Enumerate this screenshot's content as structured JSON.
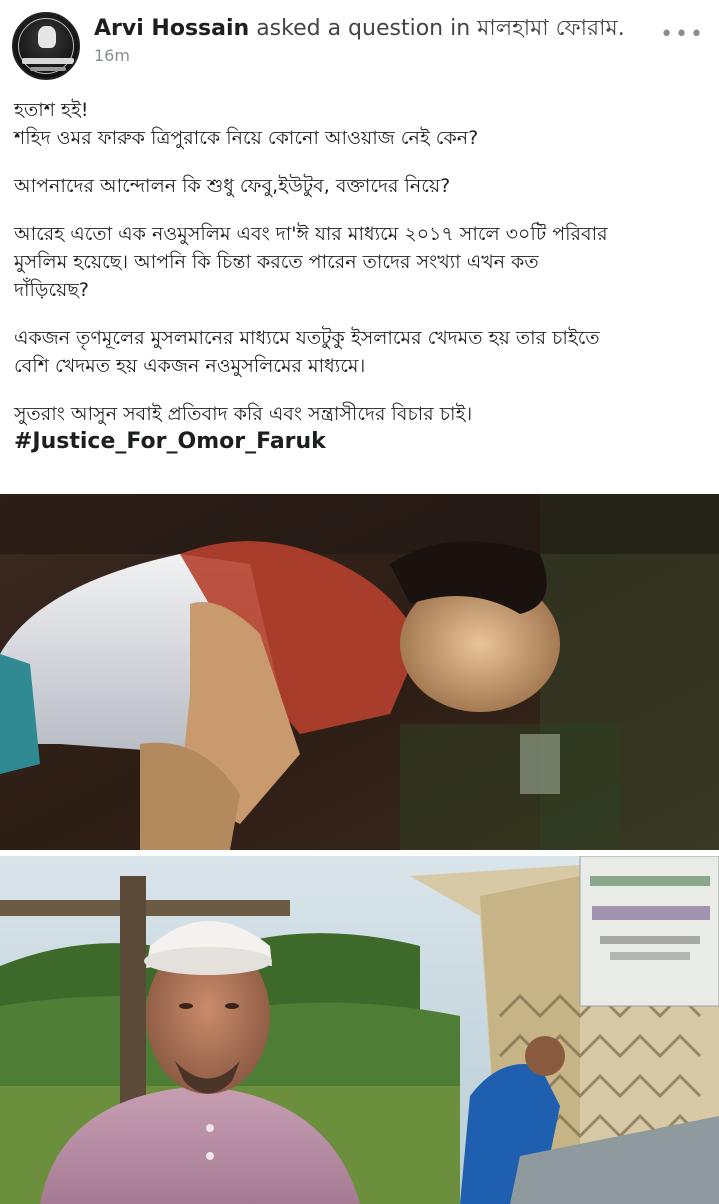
{
  "post": {
    "author": "Arvi Hossain",
    "action": "asked a question in",
    "group": "মালহামা ফোরাম.",
    "time": "16m",
    "more_icon": "more-horizontal-icon",
    "lines": [
      [
        "হতাশ হই!",
        "শহিদ ওমর ফারুক ত্রিপুরাকে নিয়ে কোনো আওয়াজ নেই কেন?"
      ],
      [
        "আপনাদের আন্দোলন কি শুধু ফেবু,ইউটুব, বক্তাদের নিয়ে?"
      ],
      [
        "আরেহ এতো এক নওমুসলিম এবং দা'ঈ যার মাধ্যমে ২০১৭ সালে ৩০টি পরিবার",
        "মুসলিম হয়েছে।  আপনি কি চিন্তা করতে পারেন তাদের সংখ্যা এখন কত",
        "দাঁড়িয়েছ?"
      ],
      [
        "একজন তৃণমূলের মুসলমানের মাধ্যমে যতটুকু ইসলামের খেদমত হয় তার চাইতে",
        "বেশি খেদমত হয় একজন নওমুসলিমের মাধ্যমে।"
      ],
      [
        "সুতরাং আসুন সবাই প্রতিবাদ করি এবং সন্ত্রাসীদের বিচার চাই।"
      ]
    ],
    "hashtag": "#Justice_For_Omor_Faruk"
  },
  "photos": [
    {
      "icon": "photo-injured-man"
    },
    {
      "icon": "photo-man-in-cap-village"
    }
  ]
}
